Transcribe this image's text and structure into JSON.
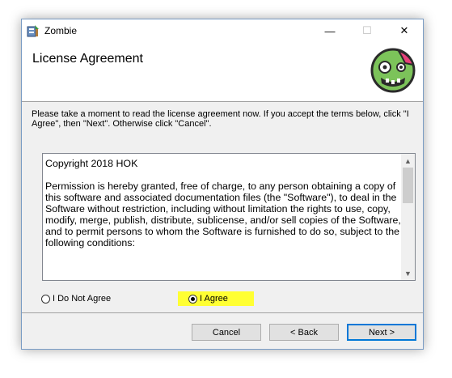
{
  "window": {
    "title": "Zombie",
    "app_icon": "installer-icon",
    "controls": {
      "minimize": "—",
      "maximize": "☐",
      "close": "✕"
    }
  },
  "header": {
    "title": "License Agreement",
    "logo": "zombie-face-logo"
  },
  "intro_text": "Please take a moment to read the license agreement now. If you accept the terms below, click \"I Agree\", then \"Next\". Otherwise click \"Cancel\".",
  "license": {
    "paragraphs": [
      "Copyright 2018 HOK",
      "Permission is hereby granted, free of charge, to any person obtaining a copy of this software and associated documentation files (the \"Software\"), to deal in the Software without restriction, including without limitation the rights to use, copy, modify, merge, publish, distribute, sublicense, and/or sell copies of the Software, and to permit persons to whom the Software is furnished to do so, subject to the following conditions:"
    ],
    "scroll_up": "▲",
    "scroll_down": "▼"
  },
  "options": {
    "disagree_label": "I Do Not Agree",
    "agree_label": "I Agree",
    "selected": "agree",
    "highlight_color": "#ffff33"
  },
  "buttons": {
    "cancel": "Cancel",
    "back": "< Back",
    "next": "Next >"
  },
  "colors": {
    "accent": "#0078d7",
    "logo_green": "#7cc35a",
    "logo_pink": "#e8407a"
  }
}
